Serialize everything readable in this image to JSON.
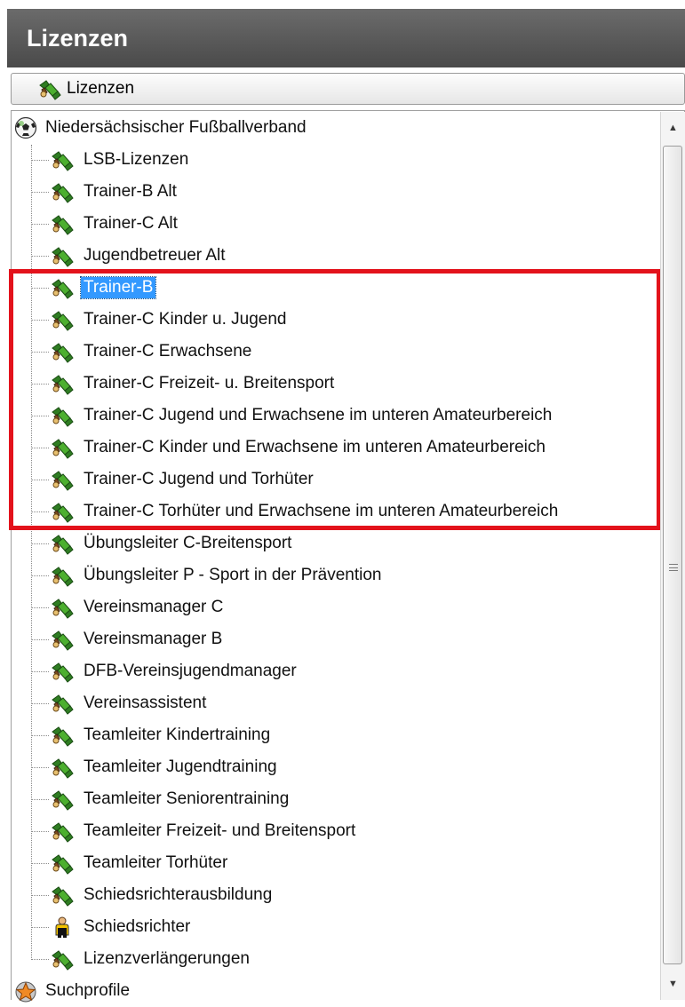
{
  "panel": {
    "title": "Lizenzen"
  },
  "toolbar": {
    "button_label": "Lizenzen",
    "icon": "license-icon"
  },
  "tree": {
    "root": {
      "label": "Niedersächsischer Fußballverband",
      "icon": "soccer-ball-icon"
    },
    "items": [
      {
        "label": "LSB-Lizenzen",
        "icon": "license-icon"
      },
      {
        "label": "Trainer-B Alt",
        "icon": "license-icon"
      },
      {
        "label": "Trainer-C Alt",
        "icon": "license-icon"
      },
      {
        "label": "Jugendbetreuer Alt",
        "icon": "license-icon"
      },
      {
        "label": "Trainer-B",
        "icon": "license-icon",
        "selected": true
      },
      {
        "label": "Trainer-C Kinder u. Jugend",
        "icon": "license-icon"
      },
      {
        "label": "Trainer-C Erwachsene",
        "icon": "license-icon"
      },
      {
        "label": "Trainer-C Freizeit- u. Breitensport",
        "icon": "license-icon"
      },
      {
        "label": "Trainer-C Jugend und Erwachsene im unteren Amateurbereich",
        "icon": "license-icon"
      },
      {
        "label": "Trainer-C Kinder und Erwachsene im unteren Amateurbereich",
        "icon": "license-icon"
      },
      {
        "label": "Trainer-C Jugend und Torhüter",
        "icon": "license-icon"
      },
      {
        "label": "Trainer-C Torhüter und Erwachsene im unteren Amateurbereich",
        "icon": "license-icon"
      },
      {
        "label": "Übungsleiter C-Breitensport",
        "icon": "license-icon"
      },
      {
        "label": "Übungsleiter P - Sport in der Prävention",
        "icon": "license-icon"
      },
      {
        "label": "Vereinsmanager C",
        "icon": "license-icon"
      },
      {
        "label": "Vereinsmanager B",
        "icon": "license-icon"
      },
      {
        "label": "DFB-Vereinsjugendmanager",
        "icon": "license-icon"
      },
      {
        "label": "Vereinsassistent",
        "icon": "license-icon"
      },
      {
        "label": "Teamleiter Kindertraining",
        "icon": "license-icon"
      },
      {
        "label": "Teamleiter Jugendtraining",
        "icon": "license-icon"
      },
      {
        "label": "Teamleiter Seniorentraining",
        "icon": "license-icon"
      },
      {
        "label": "Teamleiter Freizeit- und Breitensport",
        "icon": "license-icon"
      },
      {
        "label": "Teamleiter Torhüter",
        "icon": "license-icon"
      },
      {
        "label": "Schiedsrichterausbildung",
        "icon": "license-icon"
      },
      {
        "label": "Schiedsrichter",
        "icon": "referee-icon"
      },
      {
        "label": "Lizenzverlängerungen",
        "icon": "license-icon"
      }
    ],
    "footer_root": {
      "label": "Suchprofile",
      "icon": "star-icon"
    }
  },
  "colors": {
    "header_bg": "#555555",
    "selection": "#3399ff",
    "highlight_frame": "#e3121b",
    "license_icon_green": "#3b8f2a"
  }
}
